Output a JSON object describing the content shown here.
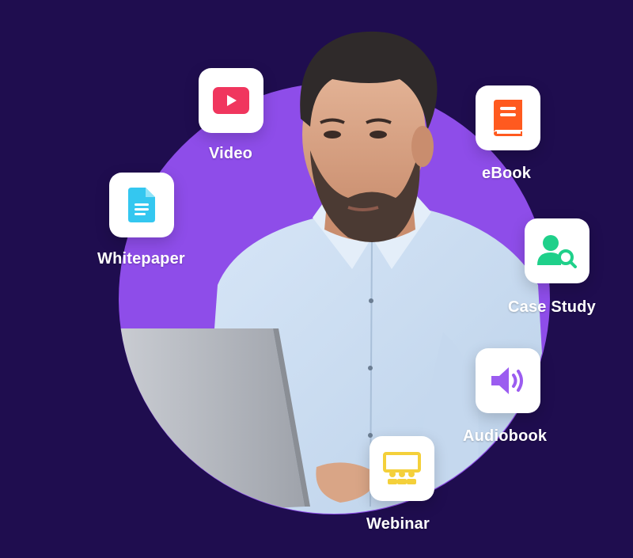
{
  "colors": {
    "background": "#1f0d4f",
    "circle": "#8e4de9",
    "video_icon": "#f0365e",
    "ebook_icon": "#ff5a1f",
    "whitepaper_icon": "#34c7f0",
    "case_study_icon": "#1fd08a",
    "audiobook_icon": "#9b5cf0",
    "webinar_icon": "#f4d03a"
  },
  "content_types": [
    {
      "label": "Video",
      "icon": "play-icon"
    },
    {
      "label": "eBook",
      "icon": "book-icon"
    },
    {
      "label": "Whitepaper",
      "icon": "document-icon"
    },
    {
      "label": "Case Study",
      "icon": "user-search-icon"
    },
    {
      "label": "Audiobook",
      "icon": "speaker-icon"
    },
    {
      "label": "Webinar",
      "icon": "presentation-icon"
    }
  ]
}
